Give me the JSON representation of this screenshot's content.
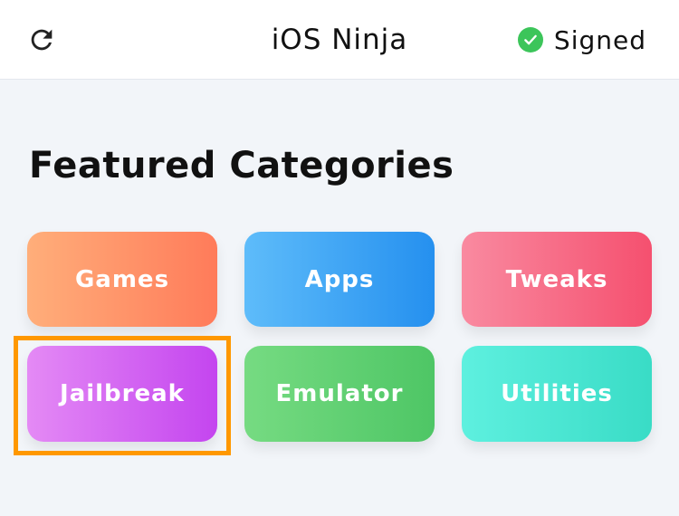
{
  "header": {
    "title": "iOS Ninja",
    "status_label": "Signed",
    "refresh_icon": "refresh-icon",
    "status_icon": "check-circle-icon",
    "status_color": "#3cc55a"
  },
  "main": {
    "section_title": "Featured Categories",
    "categories": [
      {
        "label": "Games",
        "gradient": [
          "#ffae7a",
          "#ff7b5a"
        ]
      },
      {
        "label": "Apps",
        "gradient": [
          "#5ebcfa",
          "#2590ef"
        ]
      },
      {
        "label": "Tweaks",
        "gradient": [
          "#f98aa0",
          "#f5506f"
        ]
      },
      {
        "label": "Jailbreak",
        "gradient": [
          "#e48af5",
          "#c445ef"
        ]
      },
      {
        "label": "Emulator",
        "gradient": [
          "#76db82",
          "#4ec665"
        ]
      },
      {
        "label": "Utilities",
        "gradient": [
          "#5ef0df",
          "#39dcc6"
        ]
      }
    ],
    "highlighted_category": "Jailbreak",
    "highlight_color": "#ff9800"
  }
}
